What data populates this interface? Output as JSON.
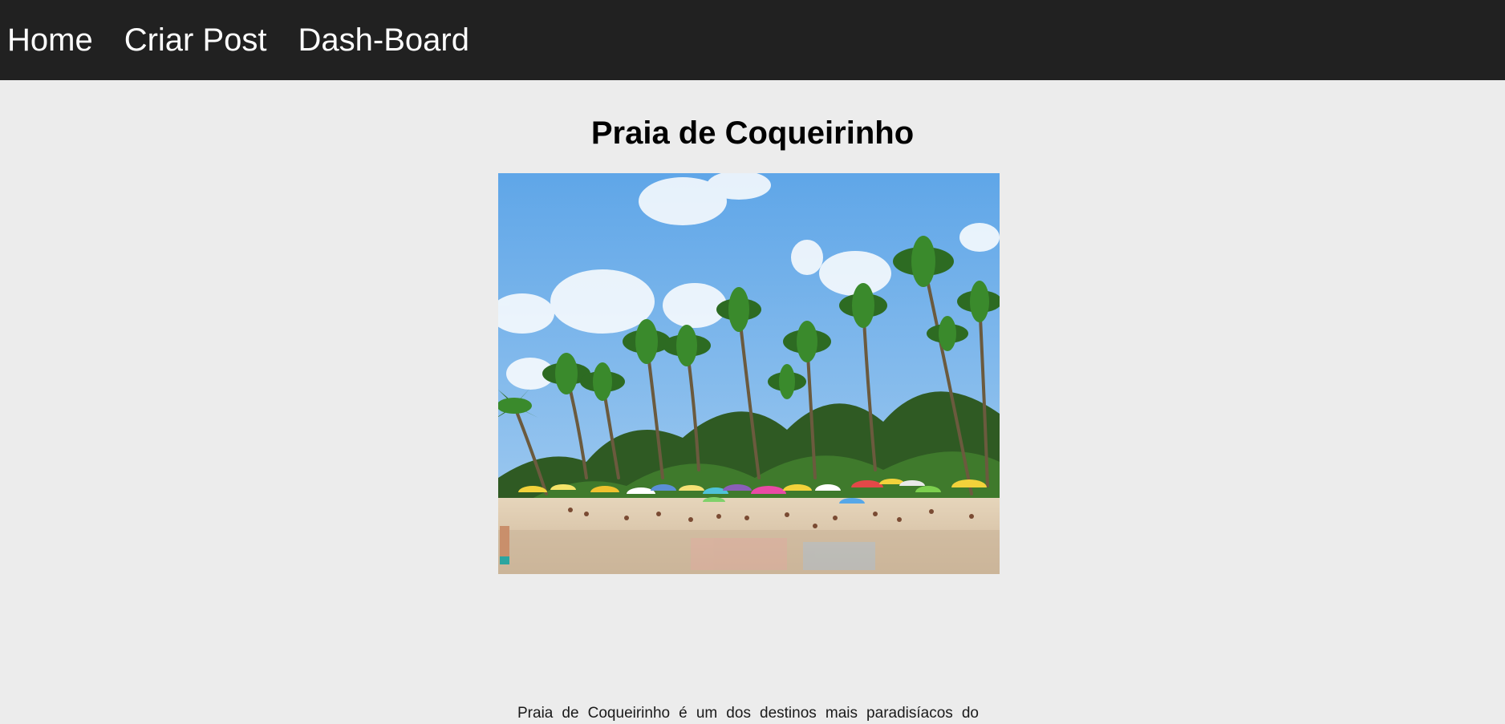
{
  "nav": {
    "items": [
      {
        "label": "Home"
      },
      {
        "label": "Criar Post"
      },
      {
        "label": "Dash-Board"
      }
    ]
  },
  "post": {
    "title": "Praia de Coqueirinho",
    "image_icon": "beach-photo",
    "text": "Praia de Coqueirinho é um dos destinos mais paradisíacos do"
  },
  "colors": {
    "nav_bg": "#212121",
    "page_bg": "#ececec",
    "sky": "#6aaee6",
    "sand": "#d9c4a6"
  }
}
